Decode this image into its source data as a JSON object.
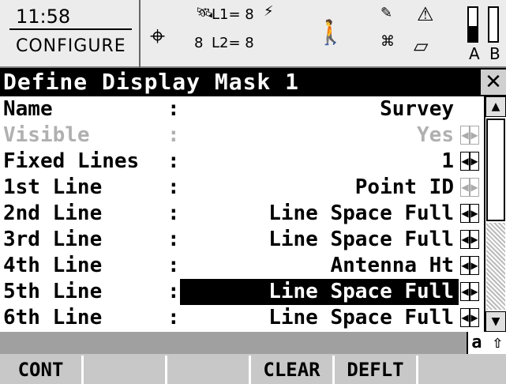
{
  "status_bar": {
    "time": "11:58",
    "mode": "CONFIGURE",
    "l1_label": "L1= 8",
    "l2_label": "L2= 8",
    "sat_count": "8",
    "battery_a": "A",
    "battery_b": "B"
  },
  "dialog": {
    "title": "Define Display Mask 1",
    "close_glyph": "✕"
  },
  "fields": [
    {
      "label": "Name",
      "value": "Survey"
    },
    {
      "label": "Visible",
      "value": "Yes"
    },
    {
      "label": "Fixed Lines",
      "value": "1"
    },
    {
      "label": "1st Line",
      "value": "Point ID"
    },
    {
      "label": "2nd Line",
      "value": "Line Space Full"
    },
    {
      "label": "3rd Line",
      "value": "Line Space Full"
    },
    {
      "label": "4th Line",
      "value": "Antenna Ht"
    },
    {
      "label": "5th Line",
      "value": "Line Space Full"
    },
    {
      "label": "6th Line",
      "value": "Line Space Full"
    }
  ],
  "separator": ":",
  "input_mode": "a ⇧",
  "softkeys": [
    "CONT",
    "",
    "",
    "CLEAR",
    "DEFLT",
    ""
  ]
}
